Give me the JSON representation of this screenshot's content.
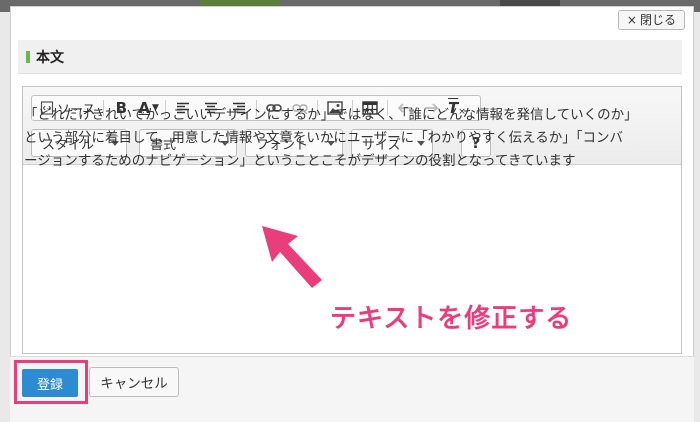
{
  "dialog": {
    "close_label": "閉じる",
    "close_icon": "×"
  },
  "section": {
    "title": "本文"
  },
  "toolbar": {
    "source_label": "ソース",
    "bold_label": "B",
    "font_color_label": "A",
    "clear_format_label": "T",
    "help_label": "?"
  },
  "combos": {
    "style": "スタイル",
    "format": "書式",
    "font": "フォント",
    "size": "サイズ"
  },
  "editor": {
    "text": "「どれだけきれいでかっこいいデザインにするか」ではなく、「誰にどんな情報を発信していくのか」という部分に着目して、用意した情報や文章をいかにユーザーに「わかりやすく伝えるか」「コンバージョンするためのナビゲーション」ということこそがデザインの役割となってきています"
  },
  "annotation": {
    "text": "テキストを修正する",
    "color": "#ea3d7c"
  },
  "footer": {
    "register_label": "登録",
    "cancel_label": "キャンセル"
  },
  "colors": {
    "accent": "#66bb44",
    "primary_button": "#2d8bd2",
    "highlight": "#ea3d7c"
  }
}
